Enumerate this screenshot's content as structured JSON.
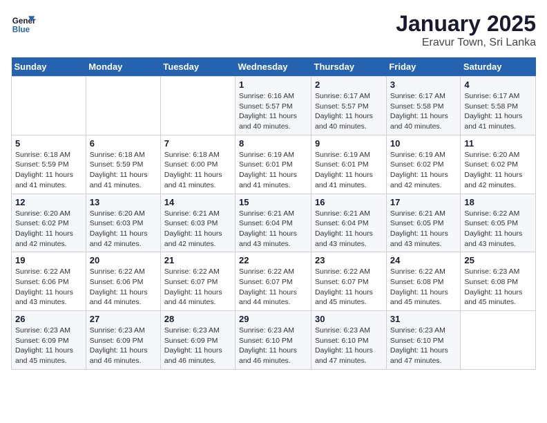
{
  "header": {
    "logo_line1": "General",
    "logo_line2": "Blue",
    "title": "January 2025",
    "subtitle": "Eravur Town, Sri Lanka"
  },
  "days_of_week": [
    "Sunday",
    "Monday",
    "Tuesday",
    "Wednesday",
    "Thursday",
    "Friday",
    "Saturday"
  ],
  "weeks": [
    [
      {
        "day": "",
        "info": ""
      },
      {
        "day": "",
        "info": ""
      },
      {
        "day": "",
        "info": ""
      },
      {
        "day": "1",
        "info": "Sunrise: 6:16 AM\nSunset: 5:57 PM\nDaylight: 11 hours and 40 minutes."
      },
      {
        "day": "2",
        "info": "Sunrise: 6:17 AM\nSunset: 5:57 PM\nDaylight: 11 hours and 40 minutes."
      },
      {
        "day": "3",
        "info": "Sunrise: 6:17 AM\nSunset: 5:58 PM\nDaylight: 11 hours and 40 minutes."
      },
      {
        "day": "4",
        "info": "Sunrise: 6:17 AM\nSunset: 5:58 PM\nDaylight: 11 hours and 41 minutes."
      }
    ],
    [
      {
        "day": "5",
        "info": "Sunrise: 6:18 AM\nSunset: 5:59 PM\nDaylight: 11 hours and 41 minutes."
      },
      {
        "day": "6",
        "info": "Sunrise: 6:18 AM\nSunset: 5:59 PM\nDaylight: 11 hours and 41 minutes."
      },
      {
        "day": "7",
        "info": "Sunrise: 6:18 AM\nSunset: 6:00 PM\nDaylight: 11 hours and 41 minutes."
      },
      {
        "day": "8",
        "info": "Sunrise: 6:19 AM\nSunset: 6:01 PM\nDaylight: 11 hours and 41 minutes."
      },
      {
        "day": "9",
        "info": "Sunrise: 6:19 AM\nSunset: 6:01 PM\nDaylight: 11 hours and 41 minutes."
      },
      {
        "day": "10",
        "info": "Sunrise: 6:19 AM\nSunset: 6:02 PM\nDaylight: 11 hours and 42 minutes."
      },
      {
        "day": "11",
        "info": "Sunrise: 6:20 AM\nSunset: 6:02 PM\nDaylight: 11 hours and 42 minutes."
      }
    ],
    [
      {
        "day": "12",
        "info": "Sunrise: 6:20 AM\nSunset: 6:02 PM\nDaylight: 11 hours and 42 minutes."
      },
      {
        "day": "13",
        "info": "Sunrise: 6:20 AM\nSunset: 6:03 PM\nDaylight: 11 hours and 42 minutes."
      },
      {
        "day": "14",
        "info": "Sunrise: 6:21 AM\nSunset: 6:03 PM\nDaylight: 11 hours and 42 minutes."
      },
      {
        "day": "15",
        "info": "Sunrise: 6:21 AM\nSunset: 6:04 PM\nDaylight: 11 hours and 43 minutes."
      },
      {
        "day": "16",
        "info": "Sunrise: 6:21 AM\nSunset: 6:04 PM\nDaylight: 11 hours and 43 minutes."
      },
      {
        "day": "17",
        "info": "Sunrise: 6:21 AM\nSunset: 6:05 PM\nDaylight: 11 hours and 43 minutes."
      },
      {
        "day": "18",
        "info": "Sunrise: 6:22 AM\nSunset: 6:05 PM\nDaylight: 11 hours and 43 minutes."
      }
    ],
    [
      {
        "day": "19",
        "info": "Sunrise: 6:22 AM\nSunset: 6:06 PM\nDaylight: 11 hours and 43 minutes."
      },
      {
        "day": "20",
        "info": "Sunrise: 6:22 AM\nSunset: 6:06 PM\nDaylight: 11 hours and 44 minutes."
      },
      {
        "day": "21",
        "info": "Sunrise: 6:22 AM\nSunset: 6:07 PM\nDaylight: 11 hours and 44 minutes."
      },
      {
        "day": "22",
        "info": "Sunrise: 6:22 AM\nSunset: 6:07 PM\nDaylight: 11 hours and 44 minutes."
      },
      {
        "day": "23",
        "info": "Sunrise: 6:22 AM\nSunset: 6:07 PM\nDaylight: 11 hours and 45 minutes."
      },
      {
        "day": "24",
        "info": "Sunrise: 6:22 AM\nSunset: 6:08 PM\nDaylight: 11 hours and 45 minutes."
      },
      {
        "day": "25",
        "info": "Sunrise: 6:23 AM\nSunset: 6:08 PM\nDaylight: 11 hours and 45 minutes."
      }
    ],
    [
      {
        "day": "26",
        "info": "Sunrise: 6:23 AM\nSunset: 6:09 PM\nDaylight: 11 hours and 45 minutes."
      },
      {
        "day": "27",
        "info": "Sunrise: 6:23 AM\nSunset: 6:09 PM\nDaylight: 11 hours and 46 minutes."
      },
      {
        "day": "28",
        "info": "Sunrise: 6:23 AM\nSunset: 6:09 PM\nDaylight: 11 hours and 46 minutes."
      },
      {
        "day": "29",
        "info": "Sunrise: 6:23 AM\nSunset: 6:10 PM\nDaylight: 11 hours and 46 minutes."
      },
      {
        "day": "30",
        "info": "Sunrise: 6:23 AM\nSunset: 6:10 PM\nDaylight: 11 hours and 47 minutes."
      },
      {
        "day": "31",
        "info": "Sunrise: 6:23 AM\nSunset: 6:10 PM\nDaylight: 11 hours and 47 minutes."
      },
      {
        "day": "",
        "info": ""
      }
    ]
  ]
}
